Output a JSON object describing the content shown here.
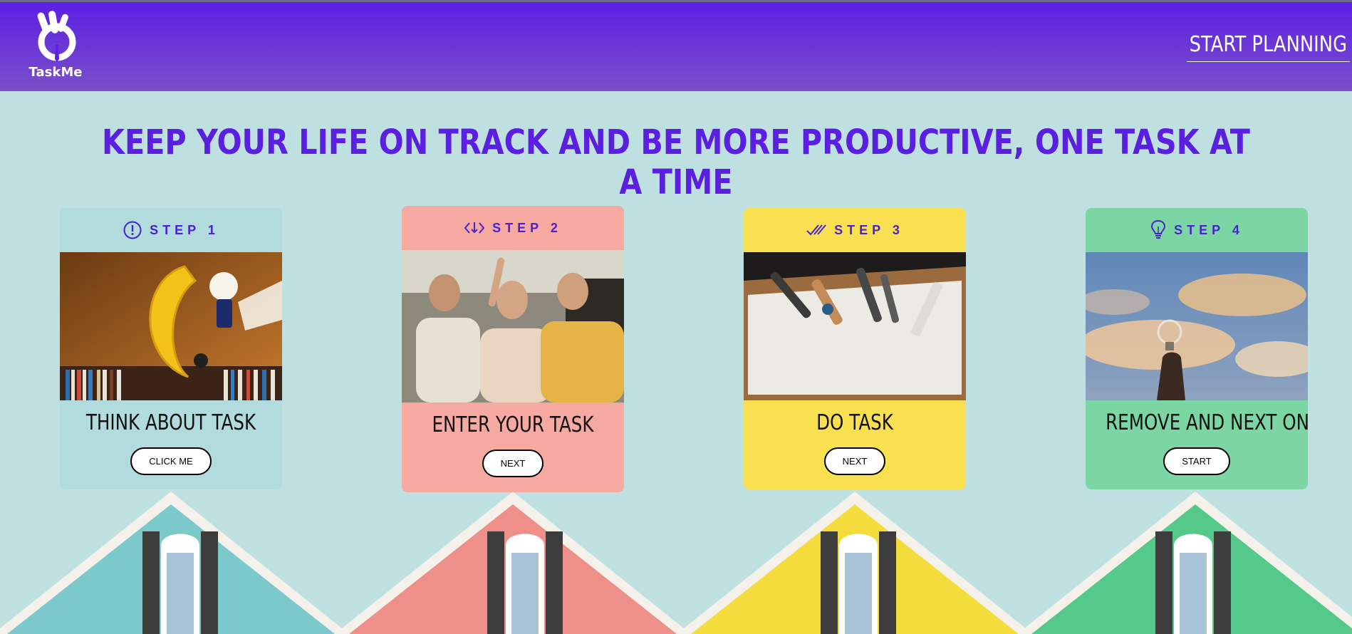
{
  "header": {
    "logo_text": "TaskMe",
    "start_planning": "START PLANNING"
  },
  "headline": "KEEP YOUR LIFE ON TRACK AND BE MORE PRODUCTIVE, ONE TASK AT A TIME",
  "colors": {
    "header": "#5c1fe4",
    "accent": "#5a1fe0",
    "background": "#bfe0e0",
    "card1": "#b1dbdc",
    "card2": "#f6a9a1",
    "card3": "#f9e051",
    "card4": "#7bd6a3"
  },
  "steps": [
    {
      "step": "STEP 1",
      "icon": "exclamation-circle-icon",
      "title": "THINK ABOUT TASK",
      "button": "CLICK ME",
      "photo": "moon-lamp-photo"
    },
    {
      "step": "STEP 2",
      "icon": "code-arrows-icon",
      "title": "ENTER YOUR TASK",
      "button": "NEXT",
      "photo": "team-whiteboard-photo"
    },
    {
      "step": "STEP 3",
      "icon": "double-check-icon",
      "title": "DO TASK",
      "button": "NEXT",
      "photo": "tools-photo"
    },
    {
      "step": "STEP 4",
      "icon": "lightbulb-icon",
      "title": "REMOVE AND NEXT ONE!",
      "button": "START",
      "photo": "bulb-sky-photo"
    }
  ]
}
